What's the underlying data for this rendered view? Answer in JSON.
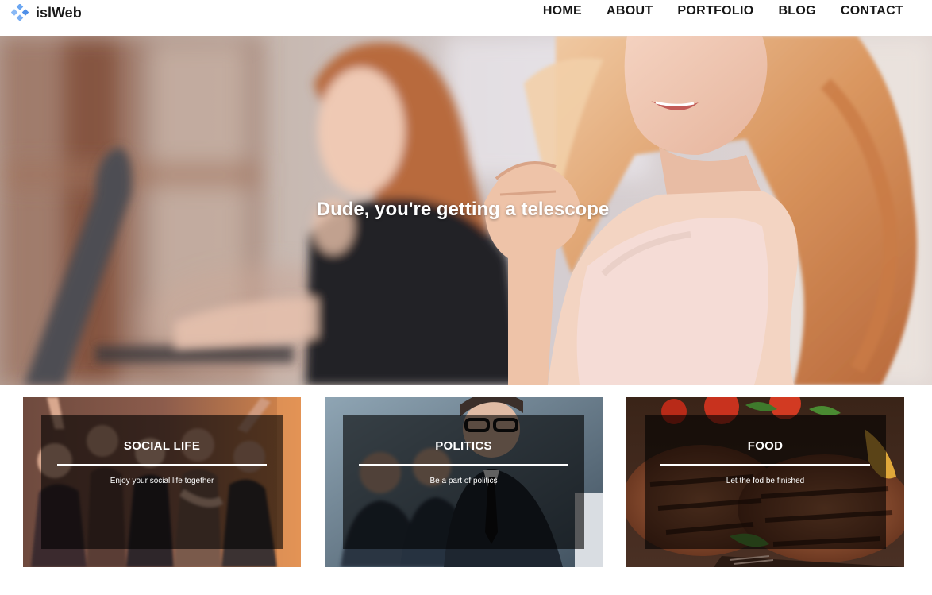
{
  "brand": {
    "name": "islWeb",
    "icon": "diamond-cluster-icon",
    "color": "#5b9cf0"
  },
  "nav": {
    "items": [
      {
        "label": "HOME"
      },
      {
        "label": "ABOUT"
      },
      {
        "label": "PORTFOLIO"
      },
      {
        "label": "BLOG"
      },
      {
        "label": "CONTACT"
      }
    ]
  },
  "hero": {
    "title": "Dude, you're getting a telescope",
    "image": "two-women-exercising-photo"
  },
  "cards": [
    {
      "title": "SOCIAL LIFE",
      "description": "Enjoy your social life together",
      "image": "party-crowd-photo"
    },
    {
      "title": "POLITICS",
      "description": "Be a part of politics",
      "image": "business-people-photo"
    },
    {
      "title": "FOOD",
      "description": "Let the fod be finished",
      "image": "grilled-steak-photo"
    }
  ]
}
